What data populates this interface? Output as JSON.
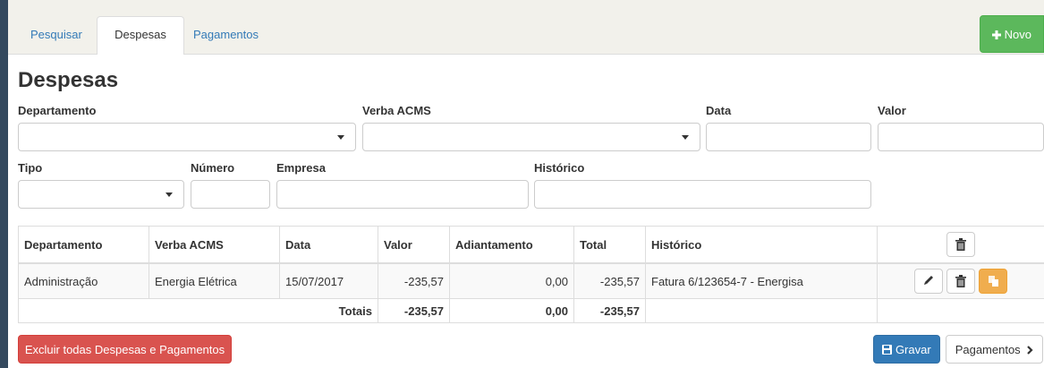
{
  "tabs": [
    {
      "label": "Pesquisar",
      "active": false
    },
    {
      "label": "Despesas",
      "active": true
    },
    {
      "label": "Pagamentos",
      "active": false
    }
  ],
  "new_button": {
    "label": "Novo",
    "icon": "plus-icon"
  },
  "page_title": "Despesas",
  "form": {
    "departamento_label": "Departamento",
    "verba_label": "Verba ACMS",
    "data_label": "Data",
    "valor_label": "Valor",
    "tipo_label": "Tipo",
    "numero_label": "Número",
    "empresa_label": "Empresa",
    "historico_label": "Histórico",
    "departamento_value": "",
    "verba_value": "",
    "data_value": "",
    "valor_value": "",
    "tipo_value": "",
    "numero_value": "",
    "empresa_value": "",
    "historico_value": ""
  },
  "table": {
    "headers": [
      "Departamento",
      "Verba ACMS",
      "Data",
      "Valor",
      "Adiantamento",
      "Total",
      "Histórico"
    ],
    "rows": [
      {
        "departamento": "Administração",
        "verba": "Energia Elétrica",
        "data": "15/07/2017",
        "valor": "-235,57",
        "adiantamento": "0,00",
        "total": "-235,57",
        "historico": "Fatura 6/123654-7 - Energisa"
      }
    ],
    "totals": {
      "label": "Totais",
      "valor": "-235,57",
      "adiantamento": "0,00",
      "total": "-235,57"
    }
  },
  "footer": {
    "delete_all_label": "Excluir todas Despesas e Pagamentos",
    "save_label": "Gravar",
    "payments_label": "Pagamentos"
  },
  "colors": {
    "success": "#5cb85c",
    "primary": "#337ab7",
    "danger": "#d9534f",
    "warning": "#f0ad4e"
  }
}
